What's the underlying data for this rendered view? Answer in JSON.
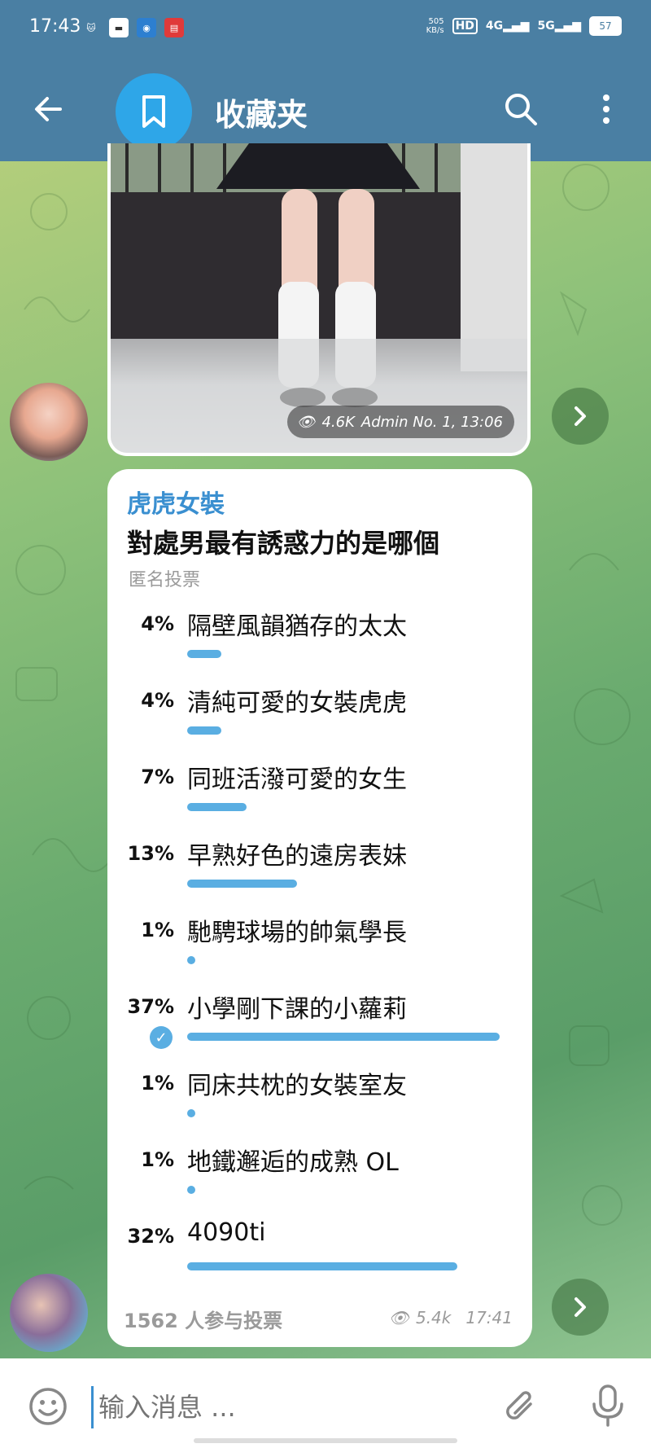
{
  "status_bar": {
    "time": "17:43",
    "network_speed_top": "505",
    "network_speed_bottom": "KB/s",
    "hd_label": "HD",
    "network_4g": "4G",
    "network_5g": "5G",
    "battery": "57"
  },
  "header": {
    "title": "收藏夹",
    "icons": [
      "back-arrow-icon",
      "bookmark-icon",
      "search-icon",
      "more-vertical-icon"
    ]
  },
  "photo_message": {
    "views": "4.6K",
    "author_time": "Admin No. 1, 13:06"
  },
  "poll": {
    "author": "虎虎女裝",
    "question": "對處男最有誘惑力的是哪個",
    "type": "匿名投票",
    "options": [
      {
        "percent": "4%",
        "text": "隔壁風韻猶存的太太",
        "value": 4,
        "chosen": false
      },
      {
        "percent": "4%",
        "text": "清純可愛的女裝虎虎",
        "value": 4,
        "chosen": false
      },
      {
        "percent": "7%",
        "text": "同班活潑可愛的女生",
        "value": 7,
        "chosen": false
      },
      {
        "percent": "13%",
        "text": "早熟好色的遠房表妹",
        "value": 13,
        "chosen": false
      },
      {
        "percent": "1%",
        "text": "馳騁球場的帥氣學長",
        "value": 1,
        "chosen": false
      },
      {
        "percent": "37%",
        "text": "小學剛下課的小蘿莉",
        "value": 37,
        "chosen": true
      },
      {
        "percent": "1%",
        "text": "同床共枕的女裝室友",
        "value": 1,
        "chosen": false
      },
      {
        "percent": "1%",
        "text": "地鐵邂逅的成熟 OL",
        "value": 1,
        "chosen": false
      },
      {
        "percent": "32%",
        "text": "4090ti",
        "value": 32,
        "chosen": false
      }
    ],
    "votes": "1562 人参与投票",
    "views": "5.4k",
    "time": "17:41"
  },
  "input": {
    "placeholder": "输入消息 ..."
  },
  "colors": {
    "header_bg": "#4a7fa3",
    "accent": "#3a8fd0",
    "poll_bar": "#5aaee2"
  }
}
